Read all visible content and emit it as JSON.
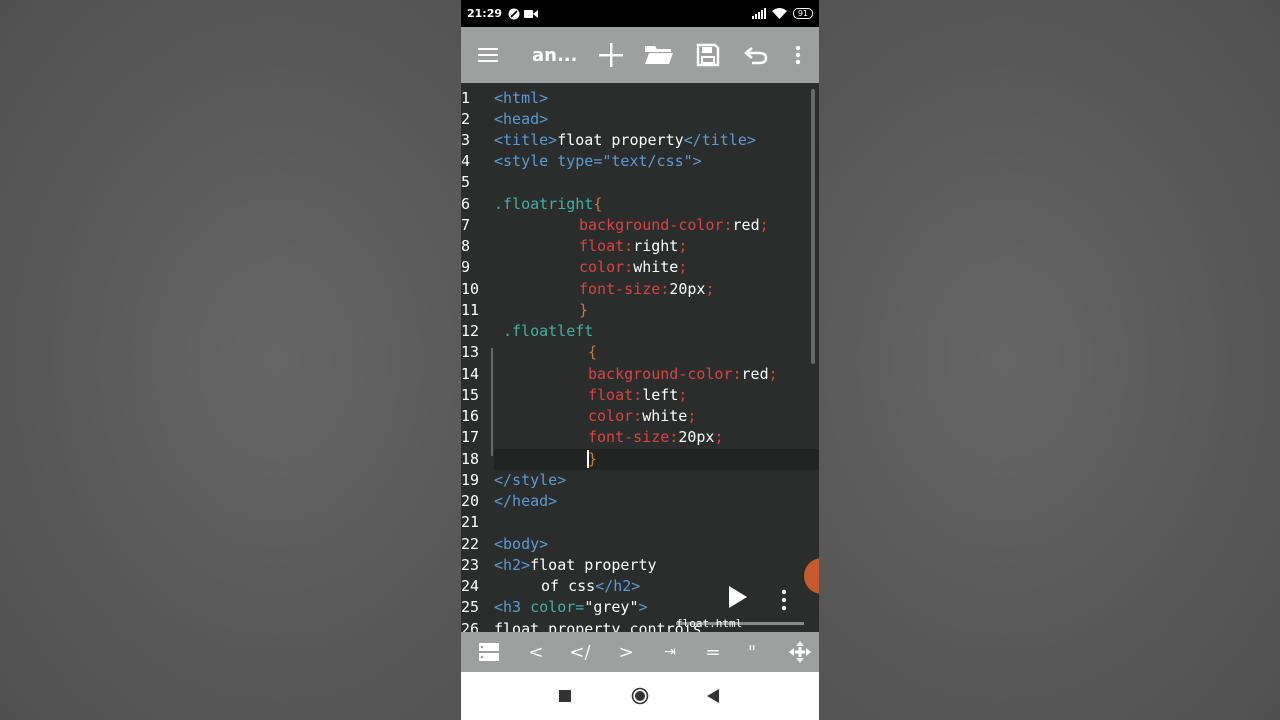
{
  "status_bar": {
    "time": "21:29",
    "battery": "91"
  },
  "toolbar": {
    "title": "an..."
  },
  "editor": {
    "line_numbers": [
      "1",
      "2",
      "3",
      "4",
      "5",
      "6",
      "7",
      "8",
      "9",
      "10",
      "11",
      "12",
      "13",
      "14",
      "15",
      "16",
      "17",
      "18",
      "19",
      "20",
      "21",
      "22",
      "23",
      "24",
      "25",
      "26"
    ],
    "lines": {
      "l1": {
        "tag": "<html>"
      },
      "l2": {
        "tag": "<head>"
      },
      "l3": {
        "open": "<title>",
        "text": "float property",
        "close": "</title>"
      },
      "l4": {
        "tag": "<style type=\"text/css\">"
      },
      "l6": {
        "selector": ".floatright",
        "brace": "{"
      },
      "l7": {
        "prop": "background-color:",
        "value": "red",
        "semi": ";"
      },
      "l8": {
        "prop": "float:",
        "value": "right",
        "semi": ";"
      },
      "l9": {
        "prop": "color:",
        "value": "white",
        "semi": ";"
      },
      "l10": {
        "prop": "font-size:",
        "value": "20px",
        "semi": ";"
      },
      "l11": {
        "brace": "}"
      },
      "l12": {
        "selector": ".floatleft"
      },
      "l13": {
        "brace": "{"
      },
      "l14": {
        "prop": "background-color:",
        "value": "red",
        "semi": ";"
      },
      "l15": {
        "prop": "float:",
        "value": "left",
        "semi": ";"
      },
      "l16": {
        "prop": "color:",
        "value": "white",
        "semi": ";"
      },
      "l17": {
        "prop": "font-size:",
        "value": "20px",
        "semi": ";"
      },
      "l18": {
        "brace": "}"
      },
      "l19": {
        "tag": "</style>"
      },
      "l20": {
        "tag": "</head>"
      },
      "l22": {
        "tag": "<body>"
      },
      "l23": {
        "open": "<h2>",
        "text": "float property"
      },
      "l24": {
        "text": "of css",
        "close": "</h2>"
      },
      "l25": {
        "open": "<h3 ",
        "attr": "color=",
        "str": "\"grey\"",
        "close": ">"
      },
      "l26": {
        "text": "float property controls"
      }
    }
  },
  "overlay": {
    "filename": "float.html"
  },
  "keybar": {
    "keys": [
      "<",
      "</",
      ">",
      "⇥",
      "=",
      "\""
    ]
  },
  "icons": {
    "menu": "menu-icon",
    "add": "plus-icon",
    "open": "folder-icon",
    "save": "save-icon",
    "undo": "undo-icon",
    "more": "more-vertical-icon",
    "play": "play-icon",
    "recent": "square-icon",
    "home": "circle-icon",
    "back": "triangle-back-icon"
  },
  "colors": {
    "toolbar_bg": "#9ea09f",
    "editor_bg": "#2b2d2c",
    "tag": "#5b9bd5",
    "property": "#d64545",
    "selector": "#3fb0a2",
    "brace": "#c87a3a"
  }
}
